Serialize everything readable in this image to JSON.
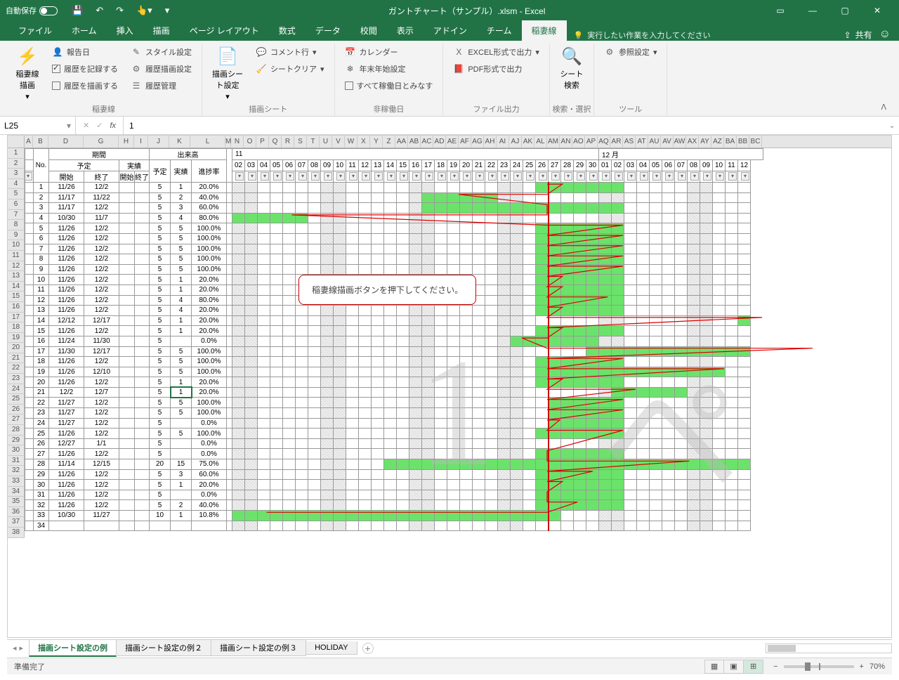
{
  "titlebar": {
    "autosave": "自動保存",
    "autosave_state": "オフ",
    "title": "ガントチャート（サンプル）.xlsm  -  Excel"
  },
  "window_buttons": {
    "ribbon_opts": "▭",
    "min": "—",
    "max": "▢",
    "close": "✕"
  },
  "ribbon_tabs": {
    "file": "ファイル",
    "home": "ホーム",
    "insert": "挿入",
    "draw": "描画",
    "layout": "ページ レイアウト",
    "formulas": "数式",
    "data": "データ",
    "review": "校閲",
    "view": "表示",
    "addin": "アドイン",
    "team": "チーム",
    "inazuma": "稲妻線",
    "tellme": "実行したい作業を入力してください",
    "share": "共有"
  },
  "ribbon": {
    "g1": {
      "big": "稲妻線\n描画",
      "label": "稲妻線",
      "b1": "報告日",
      "b2": "履歴を記録する",
      "b3": "履歴を描画する",
      "c1": "スタイル設定",
      "c2": "履歴描画設定",
      "c3": "履歴管理"
    },
    "g2": {
      "big": "描画シー\nト設定",
      "label": "描画シート",
      "b1": "コメント行",
      "b2": "シートクリア"
    },
    "g3": {
      "label": "非稼働日",
      "b1": "カレンダー",
      "b2": "年末年始設定",
      "b3": "すべて稼働日とみなす"
    },
    "g4": {
      "label": "ファイル出力",
      "b1": "EXCEL形式で出力",
      "b2": "PDF形式で出力"
    },
    "g5": {
      "big": "シート\n検索",
      "label": "検索・選択"
    },
    "g6": {
      "label": "ツール",
      "b1": "参照設定"
    }
  },
  "namebox": "L25",
  "formula": "1",
  "headers": {
    "no": "No.",
    "kikan": "期間",
    "yotei": "予定",
    "jisseki": "実績",
    "start": "開始",
    "end": "終了",
    "k_start": "開始",
    "k_end": "終了",
    "dekidaka": "出来高",
    "d_yotei": "予定",
    "d_jisseki": "実績",
    "rate": "進捗率",
    "month11": "11",
    "month12": "12 月"
  },
  "days": [
    "02",
    "03",
    "04",
    "05",
    "06",
    "07",
    "08",
    "09",
    "10",
    "11",
    "12",
    "13",
    "14",
    "15",
    "16",
    "17",
    "18",
    "19",
    "20",
    "21",
    "22",
    "23",
    "24",
    "25",
    "26",
    "27",
    "28",
    "29",
    "30",
    "01",
    "02",
    "03",
    "04",
    "05",
    "06",
    "07",
    "08",
    "09",
    "10",
    "11",
    "12"
  ],
  "weekend_idx": [
    1,
    2,
    8,
    9,
    15,
    16,
    22,
    23,
    30,
    31,
    37,
    38
  ],
  "rows": [
    {
      "no": 1,
      "s": "11/26",
      "e": "12/2",
      "py": 5,
      "pj": 1,
      "r": "20.0%",
      "gs": 25,
      "ge": 31
    },
    {
      "no": 2,
      "s": "11/17",
      "e": "11/22",
      "py": 5,
      "pj": 2,
      "r": "40.0%",
      "gs": 16,
      "ge": 21
    },
    {
      "no": 3,
      "s": "11/17",
      "e": "12/2",
      "py": 5,
      "pj": 3,
      "r": "60.0%",
      "gs": 16,
      "ge": 31
    },
    {
      "no": 4,
      "s": "10/30",
      "e": "11/7",
      "py": 5,
      "pj": 4,
      "r": "80.0%",
      "gs": 0,
      "ge": 6
    },
    {
      "no": 5,
      "s": "11/26",
      "e": "12/2",
      "py": 5,
      "pj": 5,
      "r": "100.0%",
      "gs": 25,
      "ge": 31
    },
    {
      "no": 6,
      "s": "11/26",
      "e": "12/2",
      "py": 5,
      "pj": 5,
      "r": "100.0%",
      "gs": 25,
      "ge": 31
    },
    {
      "no": 7,
      "s": "11/26",
      "e": "12/2",
      "py": 5,
      "pj": 5,
      "r": "100.0%",
      "gs": 25,
      "ge": 31
    },
    {
      "no": 8,
      "s": "11/26",
      "e": "12/2",
      "py": 5,
      "pj": 5,
      "r": "100.0%",
      "gs": 25,
      "ge": 31
    },
    {
      "no": 9,
      "s": "11/26",
      "e": "12/2",
      "py": 5,
      "pj": 5,
      "r": "100.0%",
      "gs": 25,
      "ge": 31
    },
    {
      "no": 10,
      "s": "11/26",
      "e": "12/2",
      "py": 5,
      "pj": 1,
      "r": "20.0%",
      "gs": 25,
      "ge": 31
    },
    {
      "no": 11,
      "s": "11/26",
      "e": "12/2",
      "py": 5,
      "pj": 1,
      "r": "20.0%",
      "gs": 25,
      "ge": 31
    },
    {
      "no": 12,
      "s": "11/26",
      "e": "12/2",
      "py": 5,
      "pj": 4,
      "r": "80.0%",
      "gs": 25,
      "ge": 31
    },
    {
      "no": 13,
      "s": "11/26",
      "e": "12/2",
      "py": 5,
      "pj": 4,
      "r": "20.0%",
      "gs": 25,
      "ge": 31
    },
    {
      "no": 14,
      "s": "12/12",
      "e": "12/17",
      "py": 5,
      "pj": 1,
      "r": "20.0%",
      "gs": 41,
      "ge": 46
    },
    {
      "no": 15,
      "s": "11/26",
      "e": "12/2",
      "py": 5,
      "pj": 1,
      "r": "20.0%",
      "gs": 25,
      "ge": 31
    },
    {
      "no": 16,
      "s": "11/24",
      "e": "11/30",
      "py": 5,
      "pj": "",
      "r": "0.0%",
      "gs": 23,
      "ge": 29
    },
    {
      "no": 17,
      "s": "11/30",
      "e": "12/17",
      "py": 5,
      "pj": 5,
      "r": "100.0%",
      "gs": 29,
      "ge": 46
    },
    {
      "no": 18,
      "s": "11/26",
      "e": "12/2",
      "py": 5,
      "pj": 5,
      "r": "100.0%",
      "gs": 25,
      "ge": 31
    },
    {
      "no": 19,
      "s": "11/26",
      "e": "12/10",
      "py": 5,
      "pj": 5,
      "r": "100.0%",
      "gs": 25,
      "ge": 39
    },
    {
      "no": 20,
      "s": "11/26",
      "e": "12/2",
      "py": 5,
      "pj": 1,
      "r": "20.0%",
      "gs": 25,
      "ge": 31
    },
    {
      "no": 21,
      "s": "12/2",
      "e": "12/7",
      "py": 5,
      "pj": 1,
      "r": "20.0%",
      "gs": 31,
      "ge": 36
    },
    {
      "no": 22,
      "s": "11/27",
      "e": "12/2",
      "py": 5,
      "pj": 5,
      "r": "100.0%",
      "gs": 26,
      "ge": 31
    },
    {
      "no": 23,
      "s": "11/27",
      "e": "12/2",
      "py": 5,
      "pj": 5,
      "r": "100.0%",
      "gs": 26,
      "ge": 31
    },
    {
      "no": 24,
      "s": "11/27",
      "e": "12/2",
      "py": 5,
      "pj": "",
      "r": "0.0%",
      "gs": 26,
      "ge": 31
    },
    {
      "no": 25,
      "s": "11/26",
      "e": "12/2",
      "py": 5,
      "pj": 5,
      "r": "100.0%",
      "gs": 25,
      "ge": 31
    },
    {
      "no": 26,
      "s": "12/27",
      "e": "1/1",
      "py": 5,
      "pj": "",
      "r": "0.0%",
      "gs": -1,
      "ge": -1
    },
    {
      "no": 27,
      "s": "11/26",
      "e": "12/2",
      "py": 5,
      "pj": "",
      "r": "0.0%",
      "gs": 25,
      "ge": 31
    },
    {
      "no": 28,
      "s": "11/14",
      "e": "12/15",
      "py": 20,
      "pj": 15,
      "r": "75.0%",
      "gs": 13,
      "ge": 44
    },
    {
      "no": 29,
      "s": "11/26",
      "e": "12/2",
      "py": 5,
      "pj": 3,
      "r": "60.0%",
      "gs": 25,
      "ge": 31
    },
    {
      "no": 30,
      "s": "11/26",
      "e": "12/2",
      "py": 5,
      "pj": 1,
      "r": "20.0%",
      "gs": 25,
      "ge": 31
    },
    {
      "no": 31,
      "s": "11/26",
      "e": "12/2",
      "py": 5,
      "pj": "",
      "r": "0.0%",
      "gs": 25,
      "ge": 31
    },
    {
      "no": 32,
      "s": "11/26",
      "e": "12/2",
      "py": 5,
      "pj": 2,
      "r": "40.0%",
      "gs": 25,
      "ge": 31
    },
    {
      "no": 33,
      "s": "10/30",
      "e": "11/27",
      "py": 10,
      "pj": 1,
      "r": "10.8%",
      "gs": 0,
      "ge": 26
    },
    {
      "no": 34,
      "s": "",
      "e": "",
      "py": "",
      "pj": "",
      "r": "",
      "gs": -1,
      "ge": -1
    }
  ],
  "callout": "稲妻線描画ボタンを押下してください。",
  "sheet_tabs": {
    "t1": "描画シート設定の例",
    "t2": "描画シート設定の例２",
    "t3": "描画シート設定の例３",
    "t4": "HOLIDAY"
  },
  "statusbar": {
    "ready": "準備完了",
    "zoom": "70%"
  },
  "col_letters_left": [
    "A",
    "B",
    "D",
    "G",
    "H",
    "I",
    "J",
    "K",
    "L",
    "M"
  ],
  "col_letters_days": [
    "N",
    "O",
    "P",
    "Q",
    "R",
    "S",
    "T",
    "U",
    "V",
    "W",
    "X",
    "Y",
    "Z",
    "AA",
    "AB",
    "AC",
    "AD",
    "AE",
    "AF",
    "AG",
    "AH",
    "AI",
    "AJ",
    "AK",
    "AL",
    "AM",
    "AN",
    "AO",
    "AP",
    "AQ",
    "AR",
    "AS",
    "AT",
    "AU",
    "AV",
    "AW",
    "AX",
    "AY",
    "AZ",
    "BA",
    "BB",
    "BC"
  ],
  "row_numbers_start": 1,
  "row_numbers_end": 38
}
